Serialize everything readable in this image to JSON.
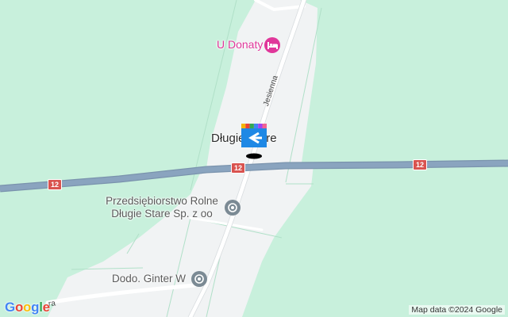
{
  "map": {
    "colors": {
      "land": "#c8f0dc",
      "settlement": "#f1f3f4",
      "highway": "#8aa4bf",
      "highway_outline": "#7a93ad",
      "road": "#ffffff",
      "hotel": "#e0379a",
      "shield": "#d9534f"
    },
    "labels": {
      "hotel": "U Donaty",
      "place": "Długie Stare",
      "company_line1": "Przedsiębiorstwo Rolne",
      "company_line2": "Długie Stare Sp. z oo",
      "company2": "Dodo. Ginter W",
      "street": "Jesienna",
      "street_cut": "ra"
    },
    "route_shields": [
      "12",
      "12",
      "12"
    ],
    "icons": {
      "hotel": "bed-icon",
      "station": "train-station-icon",
      "company": "building-icon"
    },
    "attribution": "Map data ©2024 Google",
    "google_letters": [
      "G",
      "o",
      "o",
      "g",
      "l",
      "e"
    ]
  }
}
